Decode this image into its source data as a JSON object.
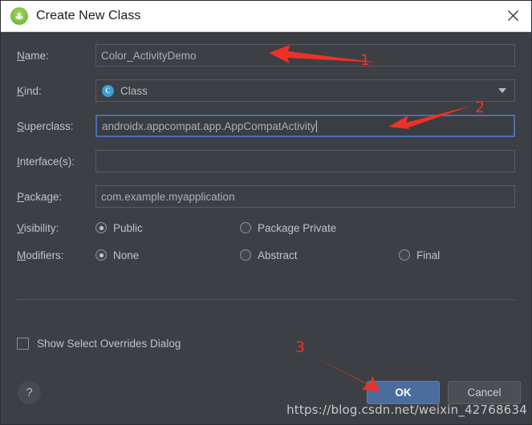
{
  "window": {
    "title": "Create New Class",
    "app_icon": "android-studio-icon",
    "close_label": "×"
  },
  "form": {
    "rows": [
      {
        "label": "Name:",
        "accesskey": "N",
        "value": "Color_ActivityDemo",
        "type": "text",
        "focused": false
      },
      {
        "label": "Kind:",
        "accesskey": "K",
        "value": "Class",
        "type": "combo",
        "focused": false
      },
      {
        "label": "Superclass:",
        "accesskey": "S",
        "value": "androidx.appcompat.app.AppCompatActivity",
        "type": "text",
        "focused": true
      },
      {
        "label": "Interface(s):",
        "accesskey": "I",
        "value": "",
        "type": "text",
        "focused": false
      },
      {
        "label": "Package:",
        "accesskey": "P",
        "value": "com.example.myapplication",
        "type": "text",
        "focused": false
      }
    ],
    "visibility": {
      "label": "Visibility:",
      "accesskey": "V",
      "options": [
        {
          "label": "Public",
          "accesskey": "u",
          "selected": true
        },
        {
          "label": "Package Private",
          "accesskey": "i",
          "selected": false
        }
      ]
    },
    "modifiers": {
      "label": "Modifiers:",
      "accesskey": "M",
      "options": [
        {
          "label": "None",
          "accesskey": "o",
          "selected": true
        },
        {
          "label": "Abstract",
          "accesskey": "A",
          "selected": false
        },
        {
          "label": "Final",
          "accesskey": "F",
          "selected": false
        }
      ]
    },
    "show_overrides": {
      "label": "Show Select Overrides Dialog",
      "accesskey": "D",
      "checked": false
    }
  },
  "footer": {
    "help_label": "?",
    "ok_label": "OK",
    "cancel_label": "Cancel"
  },
  "watermark": "https://blog.csdn.net/weixin_42768634",
  "annotations": [
    {
      "number": "1",
      "target": "name-field"
    },
    {
      "number": "2",
      "target": "superclass-field"
    },
    {
      "number": "3",
      "target": "ok-button"
    }
  ],
  "colors": {
    "dialog_background": "#3c4044",
    "titlebar_background": "#ffffff",
    "focus_border": "#4b6eaf",
    "ok_button": "#4a6d9e",
    "annotation": "#f03028",
    "kind_icon": "#389fd6"
  }
}
